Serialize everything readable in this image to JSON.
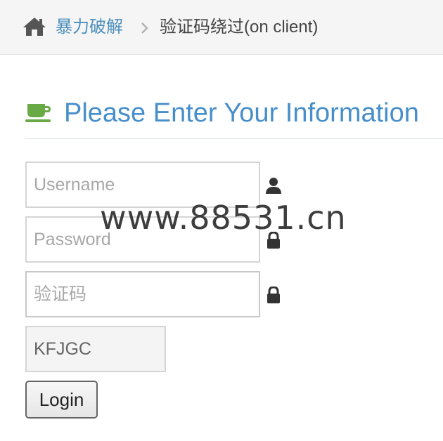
{
  "breadcrumbs": {
    "home_icon": "home-icon",
    "parent_label": "暴力破解",
    "separator_icon": "chevron-right-icon",
    "current_label": "验证码绕过(on client)"
  },
  "header": {
    "icon": "coffee-icon",
    "title": "Please Enter Your Information"
  },
  "form": {
    "username": {
      "value": "",
      "placeholder": "Username",
      "icon": "user-icon"
    },
    "password": {
      "value": "",
      "placeholder": "Password",
      "icon": "lock-icon"
    },
    "captcha": {
      "value": "",
      "placeholder": "验证码",
      "icon": "lock-icon"
    },
    "captcha_code": "KFJGC",
    "login_label": "Login"
  },
  "watermark": "www.88531.cn",
  "colors": {
    "link": "#4c8fbd",
    "title": "#478fca",
    "coffee_icon": "#69aa46",
    "breadcrumb_bg": "#f5f5f5"
  }
}
